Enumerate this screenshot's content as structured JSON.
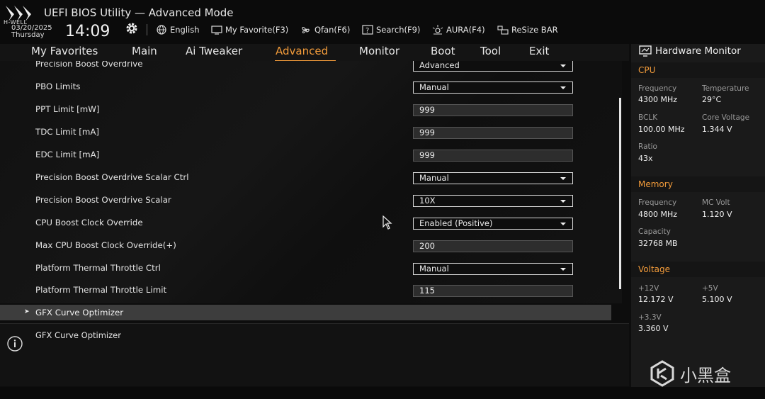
{
  "header": {
    "logo_subtitle": "H-WELL",
    "title": "UEFI BIOS Utility — Advanced Mode",
    "date": "03/20/2025",
    "day": "Thursday",
    "time": "14:09",
    "tools": [
      "English",
      "My Favorite(F3)",
      "Qfan(F6)",
      "Search(F9)",
      "AURA(F4)",
      "ReSize BAR"
    ]
  },
  "menu": {
    "items": [
      "My Favorites",
      "Main",
      "Ai Tweaker",
      "Advanced",
      "Monitor",
      "Boot",
      "Tool",
      "Exit"
    ],
    "active": "Advanced"
  },
  "settings": [
    {
      "label": "Precision Boost Overdrive",
      "value": "Advanced",
      "type": "select"
    },
    {
      "label": "PBO Limits",
      "value": "Manual",
      "type": "select"
    },
    {
      "label": "PPT Limit [mW]",
      "value": "999",
      "type": "input"
    },
    {
      "label": "TDC Limit [mA]",
      "value": "999",
      "type": "input"
    },
    {
      "label": "EDC Limit [mA]",
      "value": "999",
      "type": "input"
    },
    {
      "label": "Precision Boost Overdrive Scalar Ctrl",
      "value": "Manual",
      "type": "select"
    },
    {
      "label": "Precision Boost Overdrive Scalar",
      "value": "10X",
      "type": "select"
    },
    {
      "label": "CPU Boost Clock Override",
      "value": "Enabled (Positive)",
      "type": "select"
    },
    {
      "label": "Max CPU Boost Clock Override(+)",
      "value": "200",
      "type": "input"
    },
    {
      "label": "Platform Thermal Throttle Ctrl",
      "value": "Manual",
      "type": "select"
    },
    {
      "label": "Platform Thermal Throttle Limit",
      "value": "115",
      "type": "input"
    }
  ],
  "selected_item": {
    "label": "GFX Curve Optimizer"
  },
  "help": {
    "text": "GFX Curve Optimizer"
  },
  "hardware_monitor": {
    "title": "Hardware Monitor",
    "cpu": {
      "heading": "CPU",
      "frequency_label": "Frequency",
      "frequency": "4300 MHz",
      "temperature_label": "Temperature",
      "temperature": "29°C",
      "bclk_label": "BCLK",
      "bclk": "100.00 MHz",
      "core_voltage_label": "Core Voltage",
      "core_voltage": "1.344 V",
      "ratio_label": "Ratio",
      "ratio": "43x"
    },
    "memory": {
      "heading": "Memory",
      "frequency_label": "Frequency",
      "frequency": "4800 MHz",
      "mc_volt_label": "MC Volt",
      "mc_volt": "1.120 V",
      "capacity_label": "Capacity",
      "capacity": "32768 MB"
    },
    "voltage": {
      "heading": "Voltage",
      "v12_label": "+12V",
      "v12": "12.172 V",
      "v5_label": "+5V",
      "v5": "5.100 V",
      "v33_label": "+3.3V",
      "v33": "3.360 V"
    }
  },
  "watermark": {
    "text": "小黑盒"
  },
  "colors": {
    "accent": "#f29b3a",
    "background": "#0d0d0d",
    "panel": "#1a1a1a",
    "highlight": "#3d3d3d"
  }
}
